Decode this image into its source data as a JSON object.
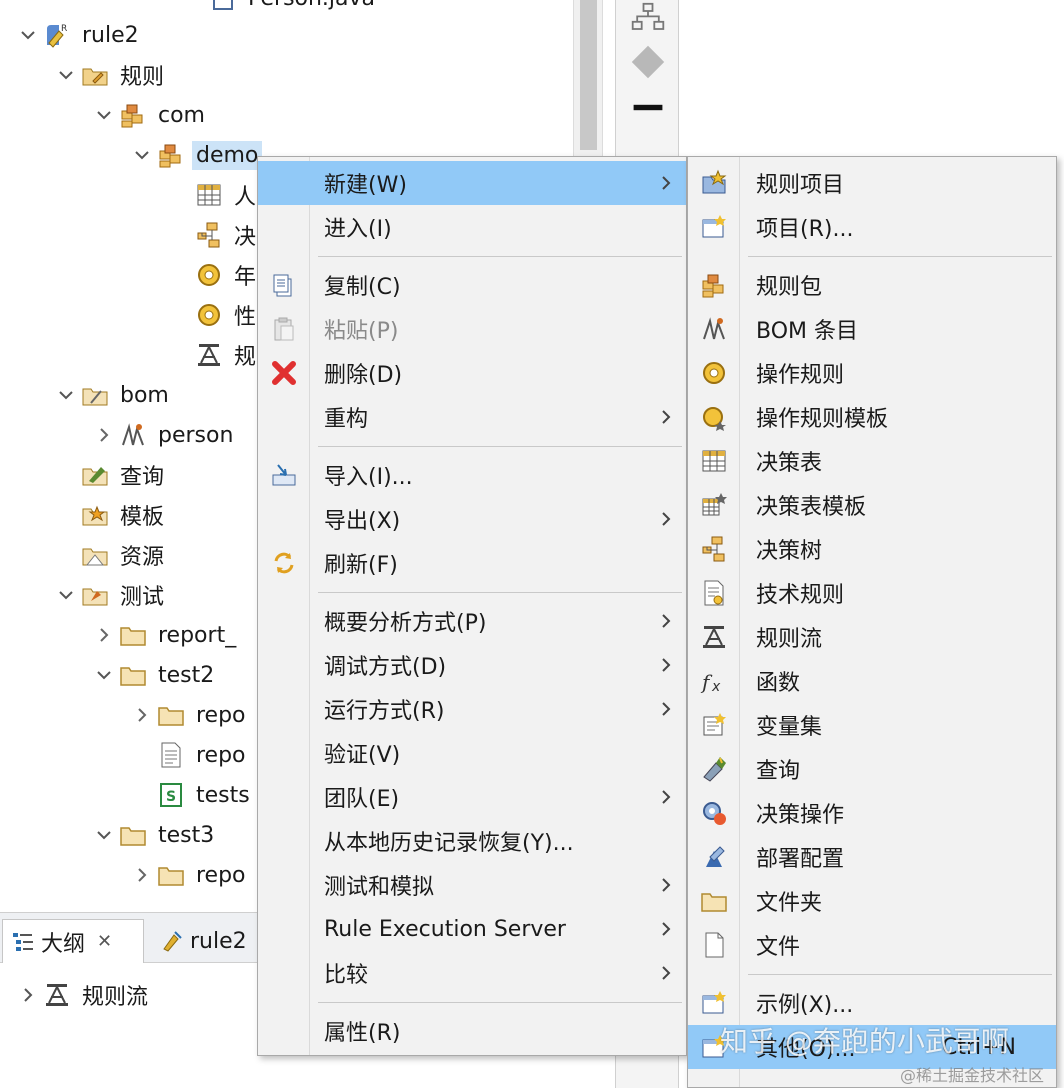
{
  "tree": {
    "partial_top_item": "Person.java",
    "items": [
      {
        "label": "rule2",
        "icon": "rule-project-icon",
        "expanded": true
      },
      {
        "label": "规则",
        "icon": "rules-folder-icon",
        "expanded": true
      },
      {
        "label": "com",
        "icon": "rule-package-icon",
        "expanded": true
      },
      {
        "label": "demo",
        "icon": "rule-package-icon",
        "expanded": true,
        "selected": true
      },
      {
        "label": "人",
        "icon": "decision-table-icon"
      },
      {
        "label": "决",
        "icon": "decision-tree-icon"
      },
      {
        "label": "年",
        "icon": "action-rule-icon"
      },
      {
        "label": "性",
        "icon": "action-rule-icon"
      },
      {
        "label": "规",
        "icon": "ruleflow-icon"
      },
      {
        "label": "bom",
        "icon": "bom-folder-icon",
        "expanded": true
      },
      {
        "label": "person",
        "icon": "bom-entry-icon",
        "expanded": false
      },
      {
        "label": "查询",
        "icon": "query-folder-icon"
      },
      {
        "label": "模板",
        "icon": "template-folder-icon"
      },
      {
        "label": "资源",
        "icon": "resource-folder-icon"
      },
      {
        "label": "测试",
        "icon": "test-folder-icon",
        "expanded": true
      },
      {
        "label": "report_",
        "icon": "folder-icon",
        "expanded": false
      },
      {
        "label": "test2",
        "icon": "folder-icon",
        "expanded": true
      },
      {
        "label": "repo",
        "icon": "folder-icon",
        "expanded": false
      },
      {
        "label": "repo",
        "icon": "text-file-icon"
      },
      {
        "label": "tests",
        "icon": "test-suite-icon"
      },
      {
        "label": "test3",
        "icon": "folder-icon",
        "expanded": true
      },
      {
        "label": "repo",
        "icon": "folder-icon",
        "expanded": false
      }
    ]
  },
  "outline": {
    "tabs": [
      {
        "label": "大纲",
        "active": true,
        "closable": true
      },
      {
        "label": "rule2",
        "active": false
      }
    ],
    "items": [
      {
        "label": "规则流"
      }
    ]
  },
  "context_menu": {
    "items": [
      {
        "label": "新建(W)",
        "submenu": true,
        "highlighted": true
      },
      {
        "label": "进入(I)"
      },
      {
        "sep": true
      },
      {
        "label": "复制(C)",
        "icon": "copy-icon"
      },
      {
        "label": "粘贴(P)",
        "icon": "paste-icon",
        "disabled": true
      },
      {
        "label": "删除(D)",
        "icon": "delete-icon"
      },
      {
        "label": "重构",
        "submenu": true
      },
      {
        "sep": true
      },
      {
        "label": "导入(I)...",
        "icon": "import-icon"
      },
      {
        "label": "导出(X)",
        "submenu": true
      },
      {
        "label": "刷新(F)",
        "icon": "refresh-icon"
      },
      {
        "sep": true
      },
      {
        "label": "概要分析方式(P)",
        "submenu": true
      },
      {
        "label": "调试方式(D)",
        "submenu": true
      },
      {
        "label": "运行方式(R)",
        "submenu": true
      },
      {
        "label": "验证(V)"
      },
      {
        "label": "团队(E)",
        "submenu": true
      },
      {
        "label": "从本地历史记录恢复(Y)..."
      },
      {
        "label": "测试和模拟",
        "submenu": true
      },
      {
        "label": "Rule Execution Server",
        "submenu": true
      },
      {
        "label": "比较",
        "submenu": true
      },
      {
        "sep": true
      },
      {
        "label": "属性(R)"
      }
    ]
  },
  "new_submenu": {
    "items": [
      {
        "label": "规则项目",
        "icon": "new-rule-project-icon"
      },
      {
        "label": "项目(R)...",
        "icon": "new-project-icon"
      },
      {
        "sep": true
      },
      {
        "label": "规则包",
        "icon": "rule-package-icon"
      },
      {
        "label": "BOM 条目",
        "icon": "bom-entry-icon"
      },
      {
        "label": "操作规则",
        "icon": "action-rule-icon"
      },
      {
        "label": "操作规则模板",
        "icon": "action-rule-template-icon"
      },
      {
        "label": "决策表",
        "icon": "decision-table-icon"
      },
      {
        "label": "决策表模板",
        "icon": "decision-table-template-icon"
      },
      {
        "label": "决策树",
        "icon": "decision-tree-icon"
      },
      {
        "label": "技术规则",
        "icon": "technical-rule-icon"
      },
      {
        "label": "规则流",
        "icon": "ruleflow-icon"
      },
      {
        "label": "函数",
        "icon": "function-icon"
      },
      {
        "label": "变量集",
        "icon": "variable-set-icon"
      },
      {
        "label": "查询",
        "icon": "query-icon"
      },
      {
        "label": "决策操作",
        "icon": "decision-operation-icon"
      },
      {
        "label": "部署配置",
        "icon": "deployment-config-icon"
      },
      {
        "label": "文件夹",
        "icon": "folder-icon"
      },
      {
        "label": "文件",
        "icon": "file-icon"
      },
      {
        "sep": true
      },
      {
        "label": "示例(X)...",
        "icon": "example-icon"
      },
      {
        "label": "其他(O)...",
        "icon": "other-icon",
        "shortcut": "Ctrl+N",
        "highlighted": true
      }
    ]
  },
  "watermark": "知乎 @奔跑的小武哥啊",
  "watermark2": "@稀土掘金技术社区",
  "colors": {
    "highlight": "#91c9f7",
    "selection": "#cce3f7",
    "menu_bg": "#f2f2f2",
    "delete_red": "#e03030"
  }
}
